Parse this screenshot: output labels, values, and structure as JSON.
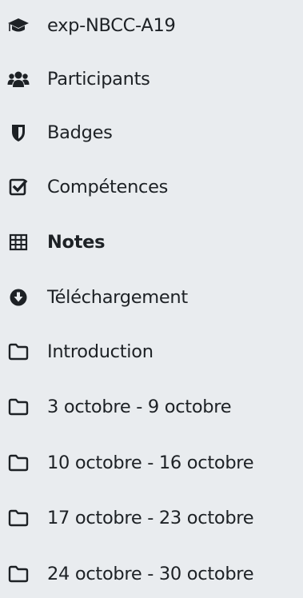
{
  "nav": {
    "items": [
      {
        "label": "exp-NBCC-A19",
        "icon": "graduation-cap-icon",
        "active": false
      },
      {
        "label": "Participants",
        "icon": "users-icon",
        "active": false
      },
      {
        "label": "Badges",
        "icon": "shield-icon",
        "active": false
      },
      {
        "label": "Compétences",
        "icon": "check-square-icon",
        "active": false
      },
      {
        "label": "Notes",
        "icon": "table-icon",
        "active": true
      },
      {
        "label": "Téléchargement",
        "icon": "download-circle-icon",
        "active": false
      },
      {
        "label": "Introduction",
        "icon": "folder-icon",
        "active": false
      },
      {
        "label": "3 octobre - 9 octobre",
        "icon": "folder-icon",
        "active": false
      },
      {
        "label": "10 octobre - 16 octobre",
        "icon": "folder-icon",
        "active": false
      },
      {
        "label": "17 octobre - 23 octobre",
        "icon": "folder-icon",
        "active": false
      },
      {
        "label": "24 octobre - 30 octobre",
        "icon": "folder-icon",
        "active": false
      }
    ]
  }
}
